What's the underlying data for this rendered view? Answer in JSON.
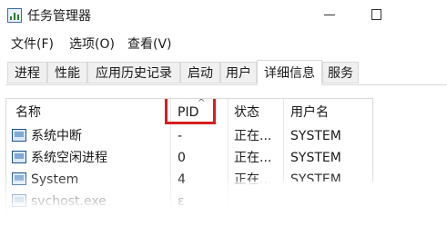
{
  "window": {
    "title": "任务管理器"
  },
  "menu": {
    "items": [
      "文件(F)",
      "选项(O)",
      "查看(V)"
    ]
  },
  "tabs": [
    {
      "label": "进程",
      "active": false
    },
    {
      "label": "性能",
      "active": false
    },
    {
      "label": "应用历史记录",
      "active": false
    },
    {
      "label": "启动",
      "active": false
    },
    {
      "label": "用户",
      "active": false
    },
    {
      "label": "详细信息",
      "active": true
    },
    {
      "label": "服务",
      "active": false
    }
  ],
  "table": {
    "columns": [
      "名称",
      "PID",
      "状态",
      "用户名"
    ],
    "sort_indicator": "^",
    "sorted_column": "PID",
    "rows": [
      {
        "name": "系统中断",
        "pid": "-",
        "status": "正在...",
        "user": "SYSTEM"
      },
      {
        "name": "系统空闲进程",
        "pid": "0",
        "status": "正在...",
        "user": "SYSTEM"
      },
      {
        "name": "System",
        "pid": "4",
        "status": "正在...",
        "user": "SYSTEM"
      },
      {
        "name": "svchost.exe",
        "pid": "ε",
        "status": "",
        "user": ""
      }
    ]
  },
  "colors": {
    "highlight": "#d61f1f",
    "active_tab_bg": "#ffffff",
    "tab_bg": "#f0f0f0"
  }
}
